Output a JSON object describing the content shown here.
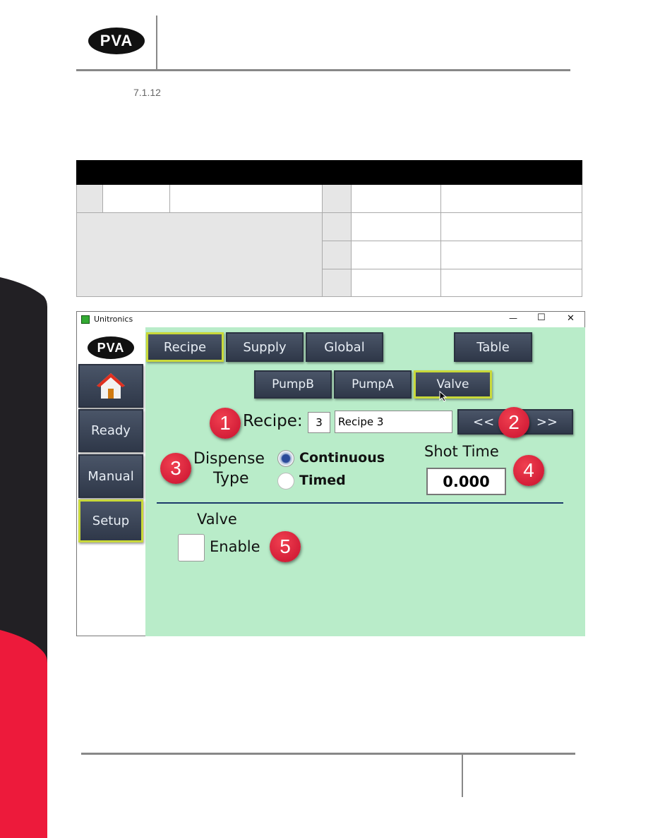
{
  "header": {
    "logo": "PVA"
  },
  "section": {
    "number": "7.1.12"
  },
  "window": {
    "title": "Unitronics",
    "controls": {
      "minimize": "—",
      "maximize": "☐",
      "close": "✕"
    },
    "logo": "PVA",
    "sidebar": [
      {
        "label": "",
        "icon": "home-icon"
      },
      {
        "label": "Ready"
      },
      {
        "label": "Manual"
      },
      {
        "label": "Setup",
        "selected": true
      }
    ],
    "tabs": [
      {
        "label": "Recipe",
        "selected": true
      },
      {
        "label": "Supply"
      },
      {
        "label": "Global"
      },
      {
        "label": "Table"
      }
    ],
    "subtabs": [
      {
        "label": "PumpB"
      },
      {
        "label": "PumpA"
      },
      {
        "label": "Valve",
        "selected": true
      }
    ],
    "recipe": {
      "label": "Recipe:",
      "number": "3",
      "name": "Recipe 3",
      "prev": "<<",
      "next": ">>"
    },
    "dispense": {
      "label1": "Dispense",
      "label2": "Type",
      "options": [
        {
          "label": "Continuous",
          "selected": true
        },
        {
          "label": "Timed",
          "selected": false
        }
      ]
    },
    "shot_time": {
      "label": "Shot Time",
      "value": "0.000"
    },
    "valve": {
      "label": "Valve",
      "enable": "Enable",
      "checked": false
    },
    "badges": [
      "1",
      "2",
      "3",
      "4",
      "5"
    ]
  },
  "colors": {
    "accent_red": "#ed1a3b",
    "panel_green": "#b9ecc9",
    "button": "#3a4456",
    "selected_border": "#c9d93a"
  }
}
